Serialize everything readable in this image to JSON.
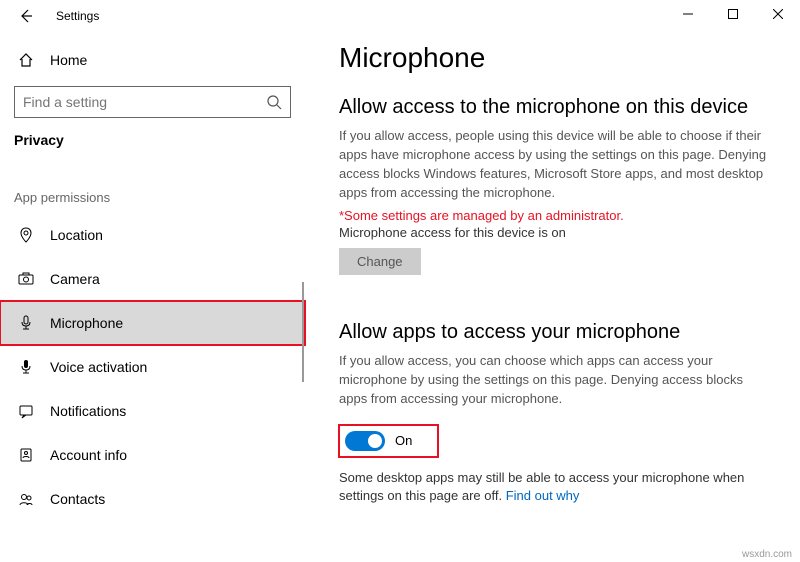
{
  "window": {
    "title": "Settings"
  },
  "sidebar": {
    "home": "Home",
    "search_placeholder": "Find a setting",
    "category": "Privacy",
    "section": "App permissions",
    "items": [
      {
        "label": "Location"
      },
      {
        "label": "Camera"
      },
      {
        "label": "Microphone"
      },
      {
        "label": "Voice activation"
      },
      {
        "label": "Notifications"
      },
      {
        "label": "Account info"
      },
      {
        "label": "Contacts"
      }
    ]
  },
  "main": {
    "title": "Microphone",
    "s1": {
      "heading": "Allow access to the microphone on this device",
      "body": "If you allow access, people using this device will be able to choose if their apps have microphone access by using the settings on this page. Denying access blocks Windows features, Microsoft Store apps, and most desktop apps from accessing the microphone.",
      "warning": "*Some settings are managed by an administrator.",
      "status": "Microphone access for this device is on",
      "change": "Change"
    },
    "s2": {
      "heading": "Allow apps to access your microphone",
      "body": "If you allow access, you can choose which apps can access your microphone by using the settings on this page. Denying access blocks apps from accessing your microphone.",
      "toggle_label": "On",
      "footnote_a": "Some desktop apps may still be able to access your microphone when settings on this page are off. ",
      "footnote_link": "Find out why"
    }
  },
  "watermark": "wsxdn.com"
}
